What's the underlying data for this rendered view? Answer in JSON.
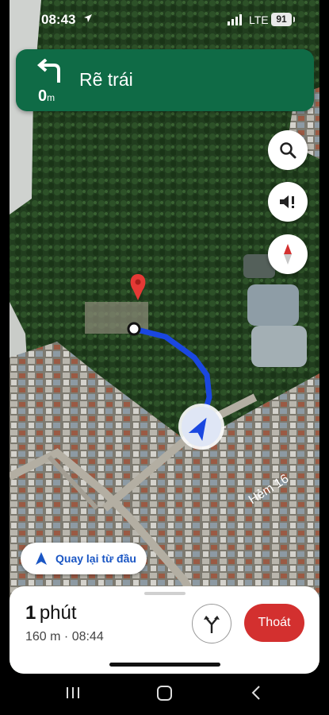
{
  "status_bar": {
    "time": "08:43",
    "network": "LTE",
    "battery": "91"
  },
  "turn_banner": {
    "distance_value": "0",
    "distance_unit": "m",
    "instruction": "Rẽ trái",
    "icon": "turn-left-arrow-icon"
  },
  "map": {
    "street_label": "Hẻm 16"
  },
  "controls": {
    "search_icon": "search-icon",
    "sound_icon": "volume-alert-icon",
    "compass_icon": "compass-icon"
  },
  "recenter": {
    "label": "Quay lại từ đầu"
  },
  "trip": {
    "eta_value": "1",
    "eta_unit": "phút",
    "meta": "160 m · 08:44",
    "exit_label": "Thoát"
  },
  "colors": {
    "banner": "#0f6b46",
    "route": "#1a47e0",
    "exit": "#d3302f",
    "accent": "#1a56c4"
  }
}
